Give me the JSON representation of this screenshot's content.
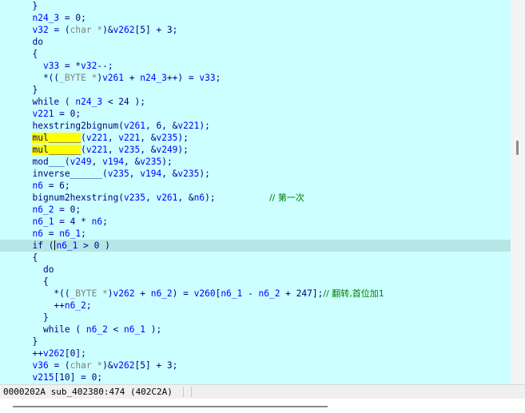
{
  "code_lines": [
    [
      [
        "p",
        "  }"
      ]
    ],
    [
      [
        "p",
        "  "
      ],
      [
        "v",
        "n24_3"
      ],
      [
        "p",
        " = 0;"
      ]
    ],
    [
      [
        "p",
        "  "
      ],
      [
        "v",
        "v32"
      ],
      [
        "p",
        " = ("
      ],
      [
        "t",
        "char *"
      ],
      [
        "p",
        ")&"
      ],
      [
        "v",
        "v262"
      ],
      [
        "p",
        "[5] + 3;"
      ]
    ],
    [
      [
        "p",
        "  "
      ],
      [
        "k",
        "do"
      ]
    ],
    [
      [
        "p",
        "  {"
      ]
    ],
    [
      [
        "p",
        "    "
      ],
      [
        "v",
        "v33"
      ],
      [
        "p",
        " = *"
      ],
      [
        "v",
        "v32"
      ],
      [
        "p",
        "--;"
      ]
    ],
    [
      [
        "p",
        "    *(("
      ],
      [
        "t",
        "_BYTE *"
      ],
      [
        "p",
        ")"
      ],
      [
        "v",
        "v261"
      ],
      [
        "p",
        " + "
      ],
      [
        "v",
        "n24_3"
      ],
      [
        "p",
        "++) = "
      ],
      [
        "v",
        "v33"
      ],
      [
        "p",
        ";"
      ]
    ],
    [
      [
        "p",
        "  }"
      ]
    ],
    [
      [
        "p",
        "  "
      ],
      [
        "k",
        "while"
      ],
      [
        "p",
        " ( "
      ],
      [
        "v",
        "n24_3"
      ],
      [
        "p",
        " < 24 );"
      ]
    ],
    [
      [
        "p",
        "  "
      ],
      [
        "v",
        "v221"
      ],
      [
        "p",
        " = 0;"
      ]
    ],
    [
      [
        "p",
        "  "
      ],
      [
        "f",
        "hexstring2bignum"
      ],
      [
        "p",
        "("
      ],
      [
        "v",
        "v261"
      ],
      [
        "p",
        ", 6, &"
      ],
      [
        "v",
        "v221"
      ],
      [
        "p",
        ");"
      ]
    ],
    [
      [
        "p",
        "  "
      ],
      [
        "y",
        "mul______"
      ],
      [
        "p",
        "("
      ],
      [
        "v",
        "v221"
      ],
      [
        "p",
        ", "
      ],
      [
        "v",
        "v221"
      ],
      [
        "p",
        ", &"
      ],
      [
        "v",
        "v235"
      ],
      [
        "p",
        ");"
      ]
    ],
    [
      [
        "p",
        "  "
      ],
      [
        "y",
        "mul______"
      ],
      [
        "p",
        "("
      ],
      [
        "v",
        "v221"
      ],
      [
        "p",
        ", "
      ],
      [
        "v",
        "v235"
      ],
      [
        "p",
        ", &"
      ],
      [
        "v",
        "v249"
      ],
      [
        "p",
        ");"
      ]
    ],
    [
      [
        "p",
        "  "
      ],
      [
        "f",
        "mod___"
      ],
      [
        "p",
        "("
      ],
      [
        "v",
        "v249"
      ],
      [
        "p",
        ", "
      ],
      [
        "v",
        "v194"
      ],
      [
        "p",
        ", &"
      ],
      [
        "v",
        "v235"
      ],
      [
        "p",
        ");"
      ]
    ],
    [
      [
        "p",
        "  "
      ],
      [
        "f",
        "inverse______"
      ],
      [
        "p",
        "("
      ],
      [
        "v",
        "v235"
      ],
      [
        "p",
        ", "
      ],
      [
        "v",
        "v194"
      ],
      [
        "p",
        ", &"
      ],
      [
        "v",
        "v235"
      ],
      [
        "p",
        ");"
      ]
    ],
    [
      [
        "p",
        "  "
      ],
      [
        "v",
        "n6"
      ],
      [
        "p",
        " = 6;"
      ]
    ],
    [
      [
        "p",
        "  "
      ],
      [
        "f",
        "bignum2hexstring"
      ],
      [
        "p",
        "("
      ],
      [
        "v",
        "v235"
      ],
      [
        "p",
        ", "
      ],
      [
        "v",
        "v261"
      ],
      [
        "p",
        ", &"
      ],
      [
        "v",
        "n6"
      ],
      [
        "p",
        ");          "
      ],
      [
        "c",
        "// 第一次"
      ]
    ],
    [
      [
        "p",
        "  "
      ],
      [
        "v",
        "n6_2"
      ],
      [
        "p",
        " = 0;"
      ]
    ],
    [
      [
        "p",
        "  "
      ],
      [
        "v",
        "n6_1"
      ],
      [
        "p",
        " = 4 * "
      ],
      [
        "v",
        "n6"
      ],
      [
        "p",
        ";"
      ]
    ],
    [
      [
        "p",
        "  "
      ],
      [
        "v",
        "n6"
      ],
      [
        "p",
        " = "
      ],
      [
        "v",
        "n6_1"
      ],
      [
        "p",
        ";"
      ]
    ],
    [
      [
        "p",
        "  "
      ],
      [
        "k",
        "if"
      ],
      [
        "p",
        " ("
      ],
      [
        "caret",
        ""
      ],
      [
        "v",
        "n6_1"
      ],
      [
        "p",
        " > 0 )"
      ]
    ],
    [
      [
        "p",
        "  {"
      ]
    ],
    [
      [
        "p",
        "    "
      ],
      [
        "k",
        "do"
      ]
    ],
    [
      [
        "p",
        "    {"
      ]
    ],
    [
      [
        "p",
        "      *(("
      ],
      [
        "t",
        "_BYTE *"
      ],
      [
        "p",
        ")"
      ],
      [
        "v",
        "v262"
      ],
      [
        "p",
        " + "
      ],
      [
        "v",
        "n6_2"
      ],
      [
        "p",
        ") = "
      ],
      [
        "v",
        "v260"
      ],
      [
        "p",
        "["
      ],
      [
        "v",
        "n6_1"
      ],
      [
        "p",
        " - "
      ],
      [
        "v",
        "n6_2"
      ],
      [
        "p",
        " + 247];"
      ],
      [
        "c",
        "// 翻转,首位加1"
      ]
    ],
    [
      [
        "p",
        "      ++"
      ],
      [
        "v",
        "n6_2"
      ],
      [
        "p",
        ";"
      ]
    ],
    [
      [
        "p",
        "    }"
      ]
    ],
    [
      [
        "p",
        "    "
      ],
      [
        "k",
        "while"
      ],
      [
        "p",
        " ( "
      ],
      [
        "v",
        "n6_2"
      ],
      [
        "p",
        " < "
      ],
      [
        "v",
        "n6_1"
      ],
      [
        "p",
        " );"
      ]
    ],
    [
      [
        "p",
        "  }"
      ]
    ],
    [
      [
        "p",
        "  ++"
      ],
      [
        "v",
        "v262"
      ],
      [
        "p",
        "[0];"
      ]
    ],
    [
      [
        "p",
        "  "
      ],
      [
        "v",
        "v36"
      ],
      [
        "p",
        " = ("
      ],
      [
        "t",
        "char *"
      ],
      [
        "p",
        ")&"
      ],
      [
        "v",
        "v262"
      ],
      [
        "p",
        "[5] + 3;"
      ]
    ],
    [
      [
        "p",
        "  "
      ],
      [
        "v",
        "v215"
      ],
      [
        "p",
        "[10] = 0;"
      ]
    ]
  ],
  "highlighted_line_index": 20,
  "status_bar": {
    "text": "0000202A sub_402380:474 (402C2A)"
  },
  "colors": {
    "editor_background": "#ccffff",
    "current_line_highlight": "#b6e6e6",
    "variable": "#0000ff",
    "plain_text": "#000080",
    "type": "#808080",
    "comment": "#008000",
    "highlight_background": "#ffff00"
  }
}
